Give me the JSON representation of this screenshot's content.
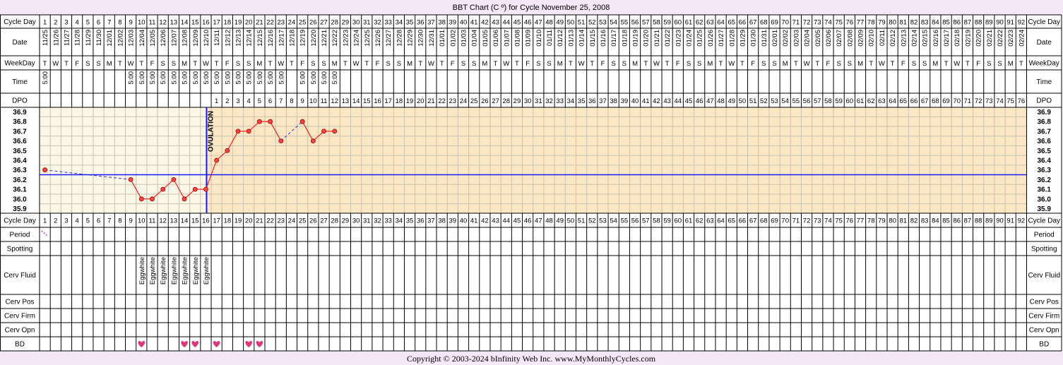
{
  "title": "BBT Chart (C º) for Cycle November 25, 2008",
  "row_labels": {
    "cycle_day": "Cycle Day",
    "date": "Date",
    "weekday": "WeekDay",
    "time": "Time",
    "dpo": "DPO",
    "period": "Period",
    "spotting": "Spotting",
    "cerv_fluid": "Cerv Fluid",
    "cerv_pos": "Cerv Pos",
    "cerv_firm": "Cerv Firm",
    "cerv_opn": "Cerv Opn",
    "bd": "BD"
  },
  "start_date": "2008-11-25",
  "num_days": 92,
  "weekdays": [
    "T",
    "W",
    "T",
    "F",
    "S",
    "S",
    "M"
  ],
  "times": [
    {
      "day": 1,
      "time": "5:00"
    },
    {
      "day": 9,
      "time": "5:00"
    },
    {
      "day": 10,
      "time": "5:00"
    },
    {
      "day": 11,
      "time": "5:00"
    },
    {
      "day": 12,
      "time": "5:00"
    },
    {
      "day": 13,
      "time": "5:00"
    },
    {
      "day": 14,
      "time": "5:00"
    },
    {
      "day": 15,
      "time": "5:00"
    },
    {
      "day": 16,
      "time": "5:00"
    },
    {
      "day": 17,
      "time": "5:00"
    },
    {
      "day": 18,
      "time": "5:00"
    },
    {
      "day": 19,
      "time": "5:00"
    },
    {
      "day": 20,
      "time": "5:00"
    },
    {
      "day": 21,
      "time": "5:00"
    },
    {
      "day": 22,
      "time": "5:00"
    },
    {
      "day": 23,
      "time": "5:00"
    },
    {
      "day": 25,
      "time": "5:00"
    },
    {
      "day": 26,
      "time": "5:00"
    },
    {
      "day": 27,
      "time": "5:00"
    },
    {
      "day": 28,
      "time": "5:00"
    }
  ],
  "dpo_start_day": 17,
  "dpo_max": 76,
  "ovulation_day": 16,
  "ovulation_label": "OVULATION",
  "coverline": 36.25,
  "chart_data": {
    "type": "line",
    "x_label": "Cycle Day",
    "y_ticks": [
      36.9,
      36.8,
      36.7,
      36.6,
      36.5,
      36.4,
      36.3,
      36.2,
      36.1,
      36.0,
      35.9
    ],
    "ylim": [
      35.9,
      36.9
    ],
    "points": [
      {
        "day": 1,
        "temp": 36.3
      },
      {
        "day": 9,
        "temp": 36.2
      },
      {
        "day": 10,
        "temp": 36.0
      },
      {
        "day": 11,
        "temp": 36.0
      },
      {
        "day": 12,
        "temp": 36.1
      },
      {
        "day": 13,
        "temp": 36.2
      },
      {
        "day": 14,
        "temp": 36.0
      },
      {
        "day": 15,
        "temp": 36.1
      },
      {
        "day": 16,
        "temp": 36.1
      },
      {
        "day": 17,
        "temp": 36.4
      },
      {
        "day": 18,
        "temp": 36.5
      },
      {
        "day": 19,
        "temp": 36.7
      },
      {
        "day": 20,
        "temp": 36.7
      },
      {
        "day": 21,
        "temp": 36.8
      },
      {
        "day": 22,
        "temp": 36.8
      },
      {
        "day": 23,
        "temp": 36.6
      },
      {
        "day": 25,
        "temp": 36.8
      },
      {
        "day": 26,
        "temp": 36.6
      },
      {
        "day": 27,
        "temp": 36.7
      },
      {
        "day": 28,
        "temp": 36.7
      }
    ]
  },
  "period_days": [
    1
  ],
  "cerv_fluid": [
    {
      "day": 10,
      "value": "Eggwhite"
    },
    {
      "day": 11,
      "value": "Eggwhite"
    },
    {
      "day": 12,
      "value": "Eggwhite"
    },
    {
      "day": 13,
      "value": "Eggwhite"
    },
    {
      "day": 14,
      "value": "Eggwhite"
    },
    {
      "day": 15,
      "value": "Eggwhite"
    },
    {
      "day": 16,
      "value": "Eggwhite"
    }
  ],
  "bd_days": [
    10,
    14,
    15,
    17,
    20,
    21
  ],
  "colors": {
    "page_bg": "#f4e8f8",
    "pre_ovulation_bg": "#fbf7e6",
    "post_ovulation_bg": "#fbe7c4",
    "coverline": "#1a1aff",
    "ovulation_line": "#1a1aff",
    "temp_line": "#ff0000",
    "temp_point": "#ff4444",
    "gap_line": "#3333cc",
    "heart": "#e0357a",
    "period": "#cc66cc"
  },
  "copyright": "Copyright © 2003-2024 bInfinity Web Inc.     www.MyMonthlyCycles.com"
}
